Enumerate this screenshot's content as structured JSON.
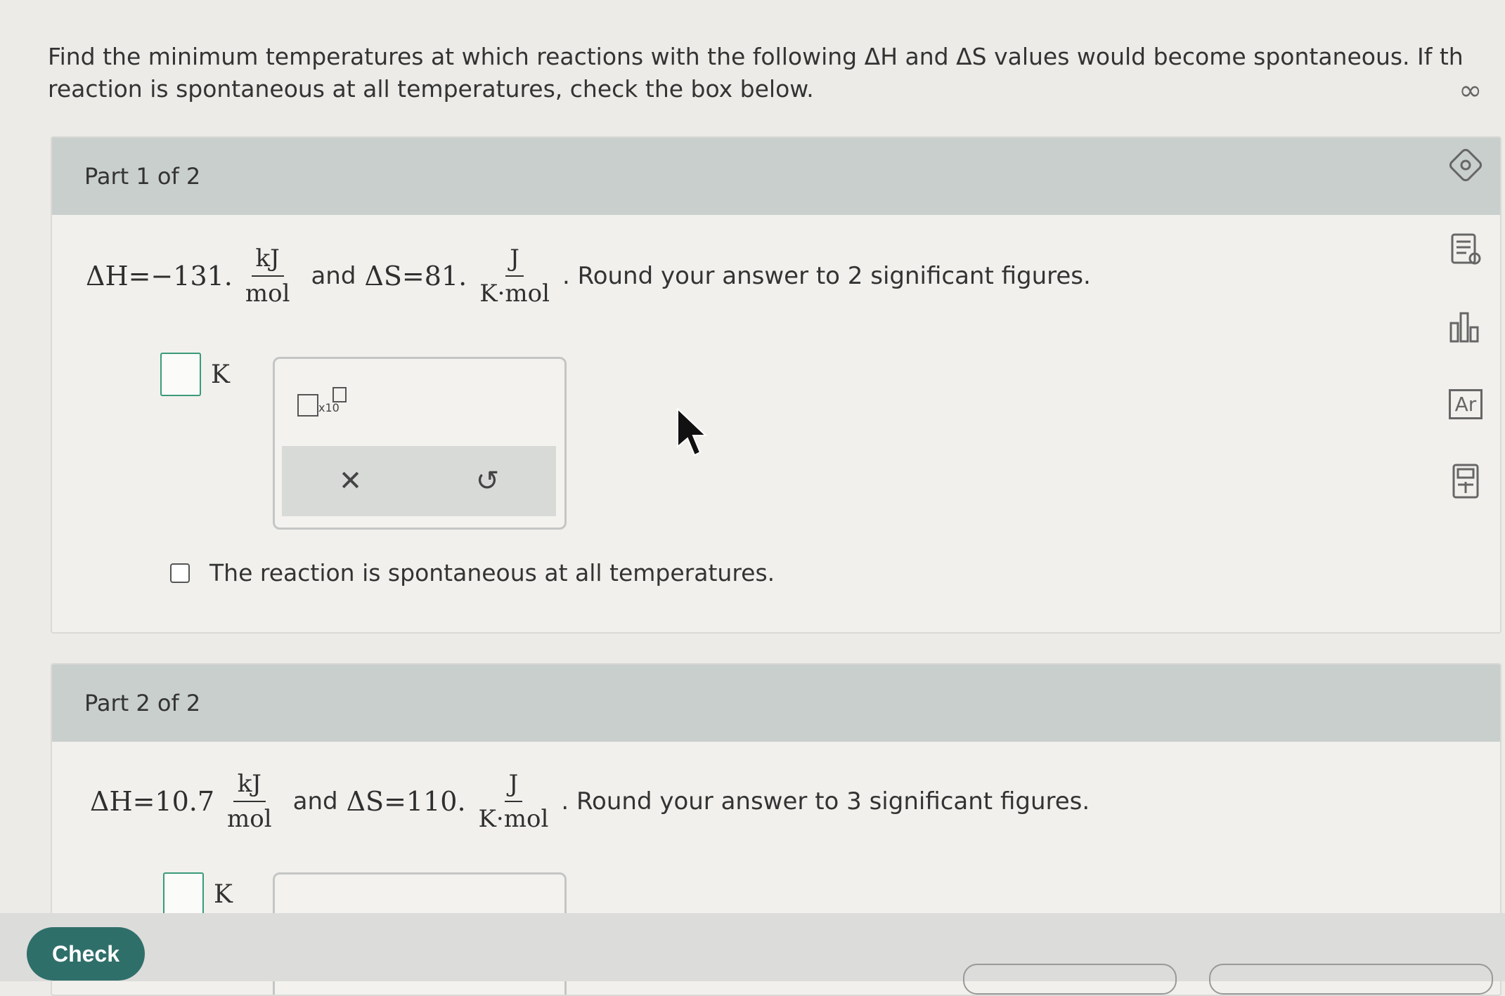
{
  "prompt": {
    "line1": "Find the minimum temperatures at which reactions with the following ΔH and ΔS values would become spontaneous. If th",
    "line2": "reaction is spontaneous at all temperatures, check the box below."
  },
  "infinity_icon": "∞",
  "part1": {
    "header": "Part 1 of 2",
    "dH_lhs": "ΔH=−131.",
    "dH_num": "kJ",
    "dH_den": "mol",
    "and": "and",
    "dS_lhs": "ΔS=81.",
    "dS_num": "J",
    "dS_den": "K·mol",
    "instruction": ". Round your answer to 2 significant figures.",
    "unit": "K",
    "x10_label": "x10",
    "clear_icon": "✕",
    "undo_icon": "↺",
    "checkbox_label": "The reaction is spontaneous at all temperatures."
  },
  "part2": {
    "header": "Part 2 of 2",
    "dH_lhs": "ΔH=10.7",
    "dH_num": "kJ",
    "dH_den": "mol",
    "and": "and",
    "dS_lhs": "ΔS=110.",
    "dS_num": "J",
    "dS_den": "K·mol",
    "instruction": ". Round your answer to 3 significant figures.",
    "unit": "K"
  },
  "toolbar": {
    "periodic_table_label": "Ar"
  },
  "check_button": "Check",
  "colors": {
    "accent": "#2f6f6a",
    "answer_border": "#3a9a7a",
    "header_bg": "#c9cfcc"
  }
}
